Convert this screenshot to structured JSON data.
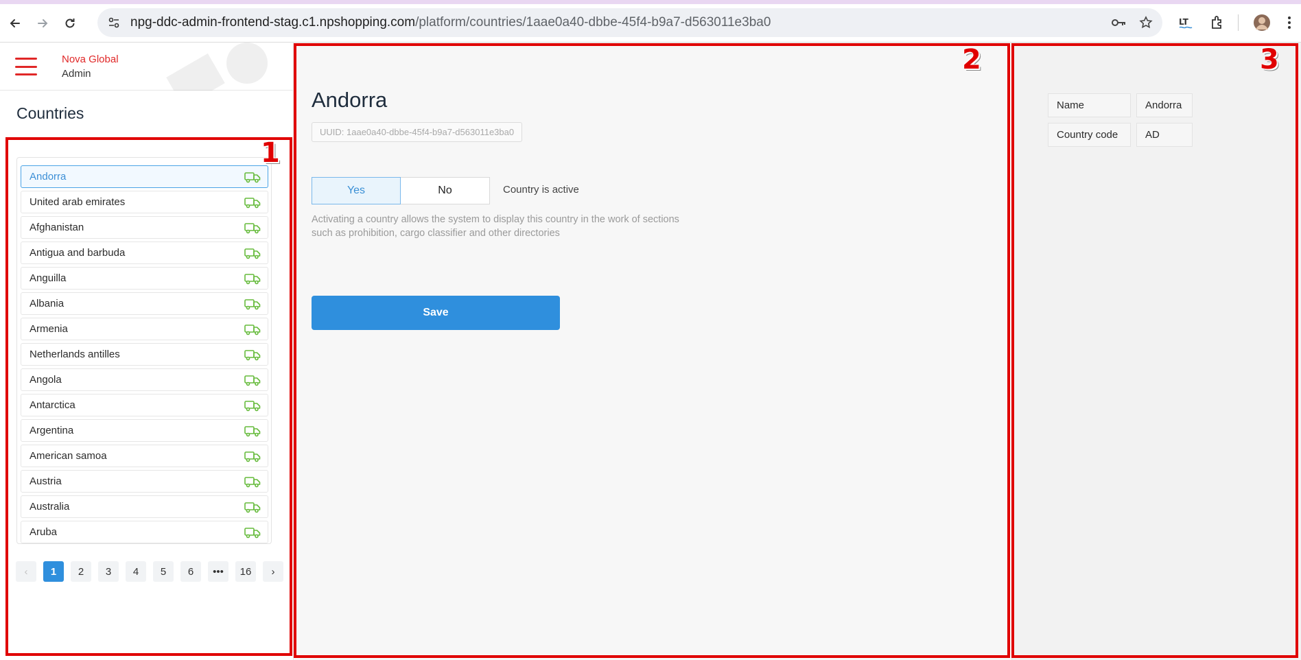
{
  "browser": {
    "url_host": "npg-ddc-admin-frontend-stag.c1.npshopping.com",
    "url_path": "/platform/countries/1aae0a40-dbbe-45f4-b9a7-d563011e3ba0"
  },
  "brand": {
    "line1": "Nova Global",
    "line2": "Admin"
  },
  "sidebar": {
    "title": "Countries",
    "countries": [
      "Andorra",
      "United arab emirates",
      "Afghanistan",
      "Antigua and barbuda",
      "Anguilla",
      "Albania",
      "Armenia",
      "Netherlands antilles",
      "Angola",
      "Antarctica",
      "Argentina",
      "American samoa",
      "Austria",
      "Australia",
      "Aruba"
    ],
    "active_index": 0
  },
  "pagination": {
    "pages": [
      "1",
      "2",
      "3",
      "4",
      "5",
      "6",
      "•••",
      "16"
    ],
    "current": "1",
    "prev": "‹",
    "next": "›"
  },
  "detail": {
    "title": "Andorra",
    "uuid": "UUID: 1aae0a40-dbbe-45f4-b9a7-d563011e3ba0",
    "toggle_yes": "Yes",
    "toggle_no": "No",
    "toggle_label": "Country is active",
    "hint_line1": "Activating a country allows the system to display this country in the work of sections",
    "hint_line2": "such as prohibition, cargo classifier and other directories",
    "save_label": "Save"
  },
  "info": {
    "name_key": "Name",
    "name_val": "Andorra",
    "code_key": "Country code",
    "code_val": "AD"
  },
  "annotations": [
    "1",
    "2",
    "3"
  ],
  "colors": {
    "brand_red": "#e02727",
    "primary_blue": "#2f8fdd",
    "truck_green": "#66bb3c",
    "annotation_red": "#e00000"
  }
}
